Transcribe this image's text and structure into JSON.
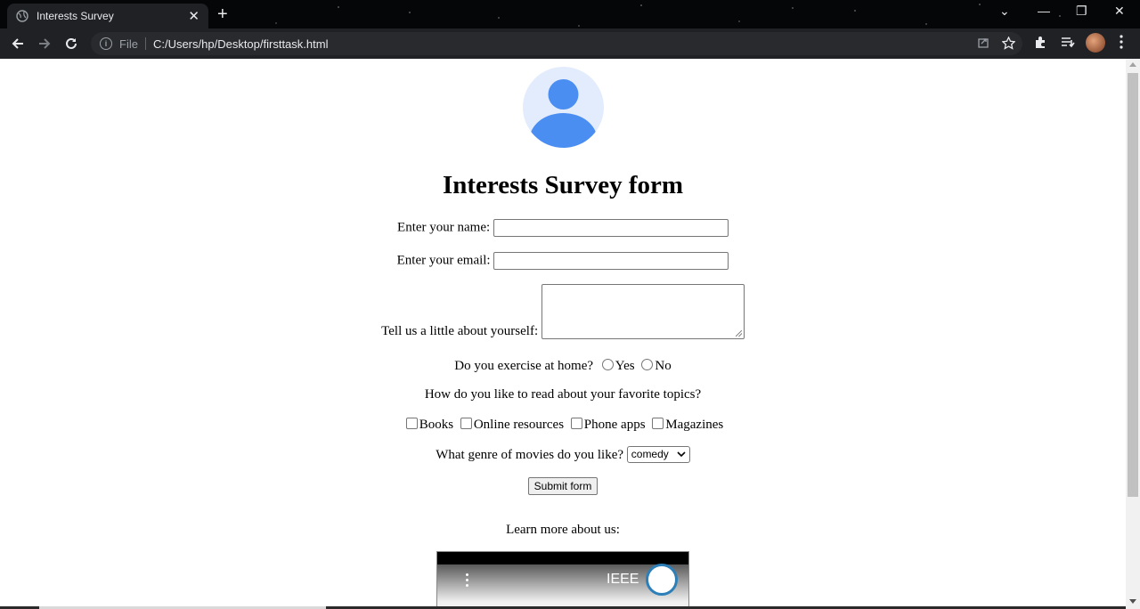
{
  "browser": {
    "tab_title": "Interests Survey",
    "tab_close": "✕",
    "new_tab": "+",
    "omnibox_scheme": "File",
    "omnibox_url": "C:/Users/hp/Desktop/firsttask.html",
    "window_controls": [
      "⌄",
      "—",
      "❐",
      "✕"
    ]
  },
  "form": {
    "heading": "Interests Survey form",
    "name_label": "Enter your name:",
    "name_value": "",
    "email_label": "Enter your email:",
    "email_value": "",
    "about_label": "Tell us a little about yourself:",
    "about_value": "",
    "exercise_question": "Do you exercise at home?",
    "exercise_options": [
      "Yes",
      "No"
    ],
    "read_question": "How do you like to read about your favorite topics?",
    "read_options": [
      "Books",
      "Online resources",
      "Phone apps",
      "Magazines"
    ],
    "movie_question": "What genre of movies do you like?",
    "movie_selected": "comedy",
    "submit_label": "Submit form"
  },
  "footer": {
    "learn_more": "Learn more about us:",
    "video_brand": "IEEE"
  },
  "colors": {
    "avatar_bg": "#e3ecfd",
    "avatar_fg": "#4b8ef2",
    "chrome_bg": "#202124"
  }
}
